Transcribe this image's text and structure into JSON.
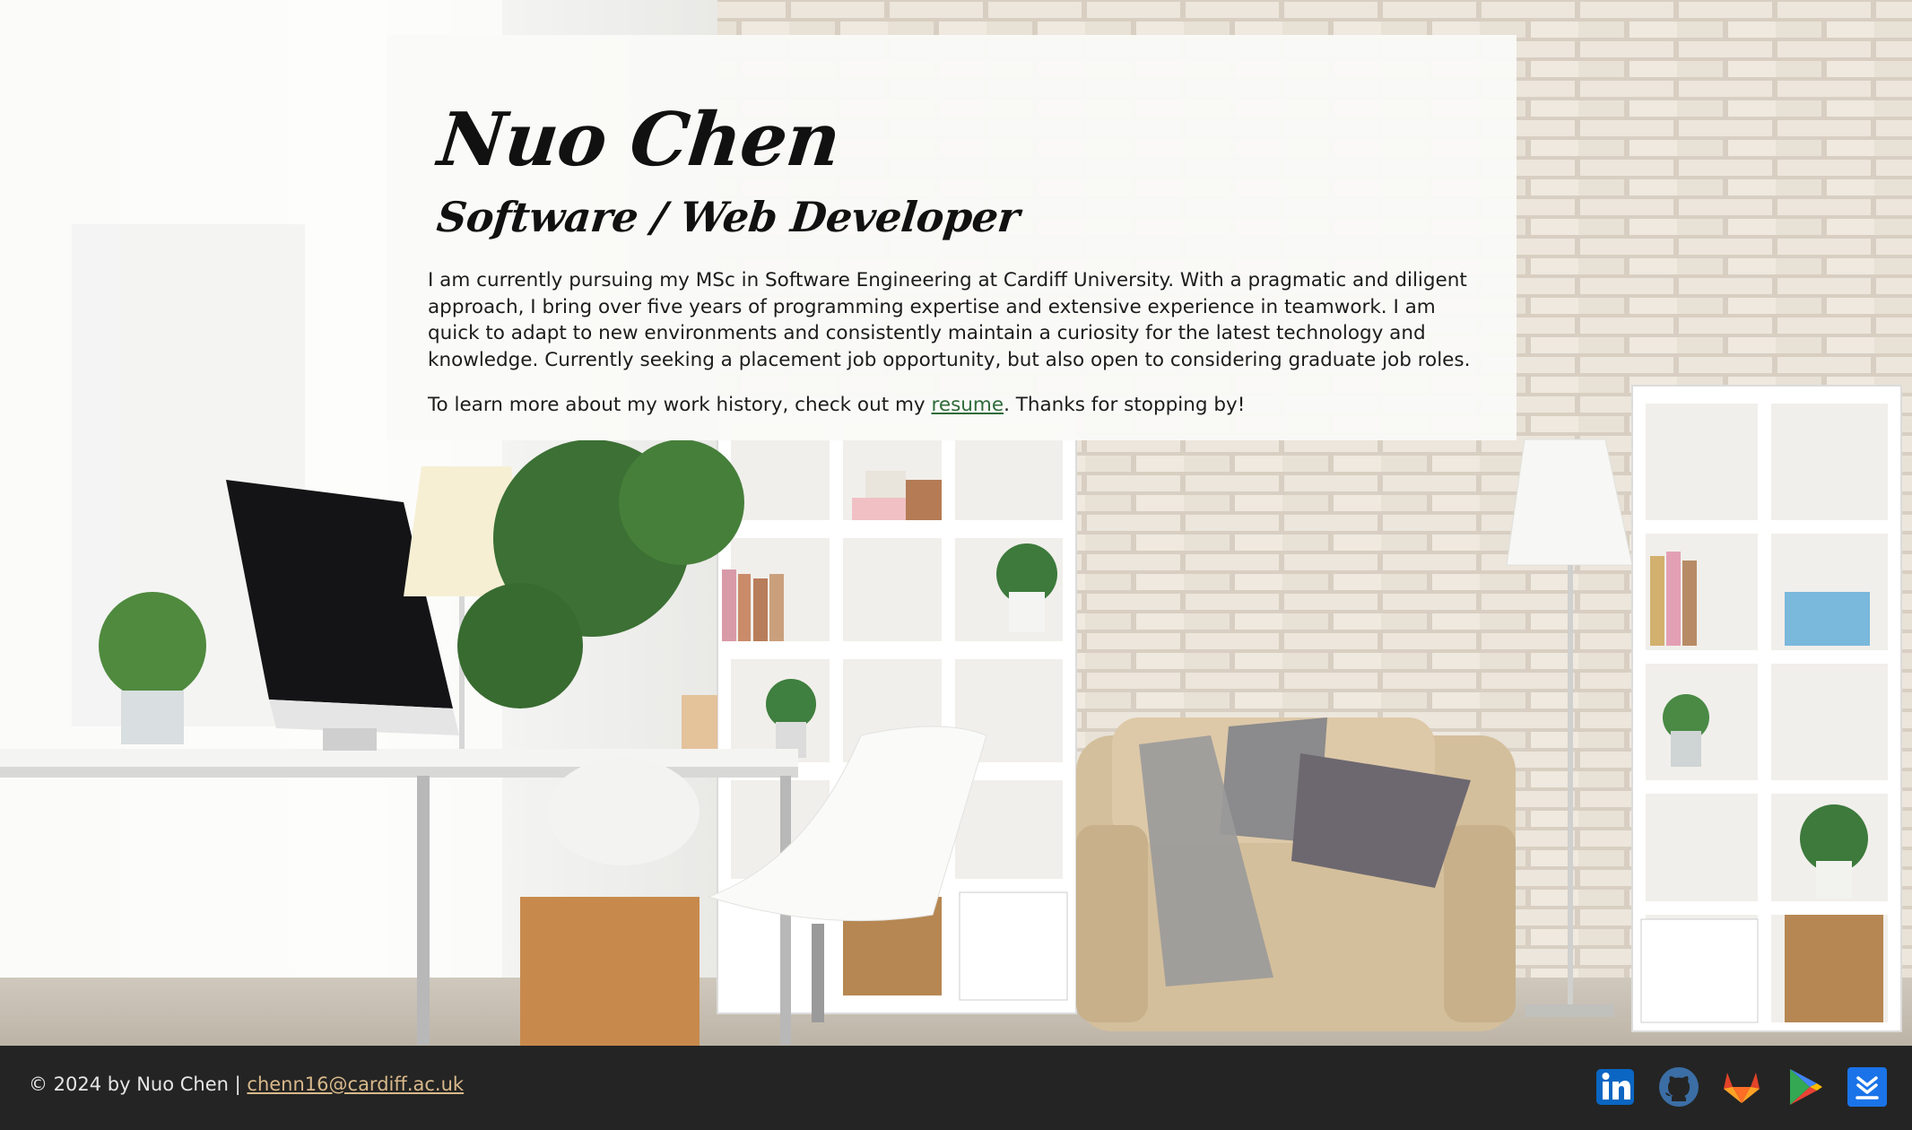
{
  "hero": {
    "name": "Nuo Chen",
    "role": "Software / Web Developer",
    "bio": "I am currently pursuing my MSc in Software Engineering at Cardiff University. With a pragmatic and diligent approach, I bring over five years of programming expertise and extensive experience in teamwork. I am quick to adapt to new environments and consistently maintain a curiosity for the latest technology and knowledge. Currently seeking a placement job opportunity, but also open to considering graduate job roles.",
    "cta_before": "To learn more about my work history, check out my ",
    "cta_link": "resume",
    "cta_after": ". Thanks for stopping by!"
  },
  "footer": {
    "copyright": "© 2024 by Nuo Chen | ",
    "email": "chenn16@cardiff.ac.uk",
    "social": [
      {
        "icon": "linkedin-icon",
        "color": "#0a66c2"
      },
      {
        "icon": "github-icon",
        "color": "#3b6ea5"
      },
      {
        "icon": "gitlab-icon",
        "color": "#e24329"
      },
      {
        "icon": "google-play-icon",
        "color": "#34a853"
      },
      {
        "icon": "download-app-icon",
        "color": "#1a73e8"
      }
    ]
  },
  "colors": {
    "link": "#2f6b3a",
    "footer_bg": "#242424",
    "footer_link": "#d8b98a",
    "card_bg": "#fafaf8"
  }
}
